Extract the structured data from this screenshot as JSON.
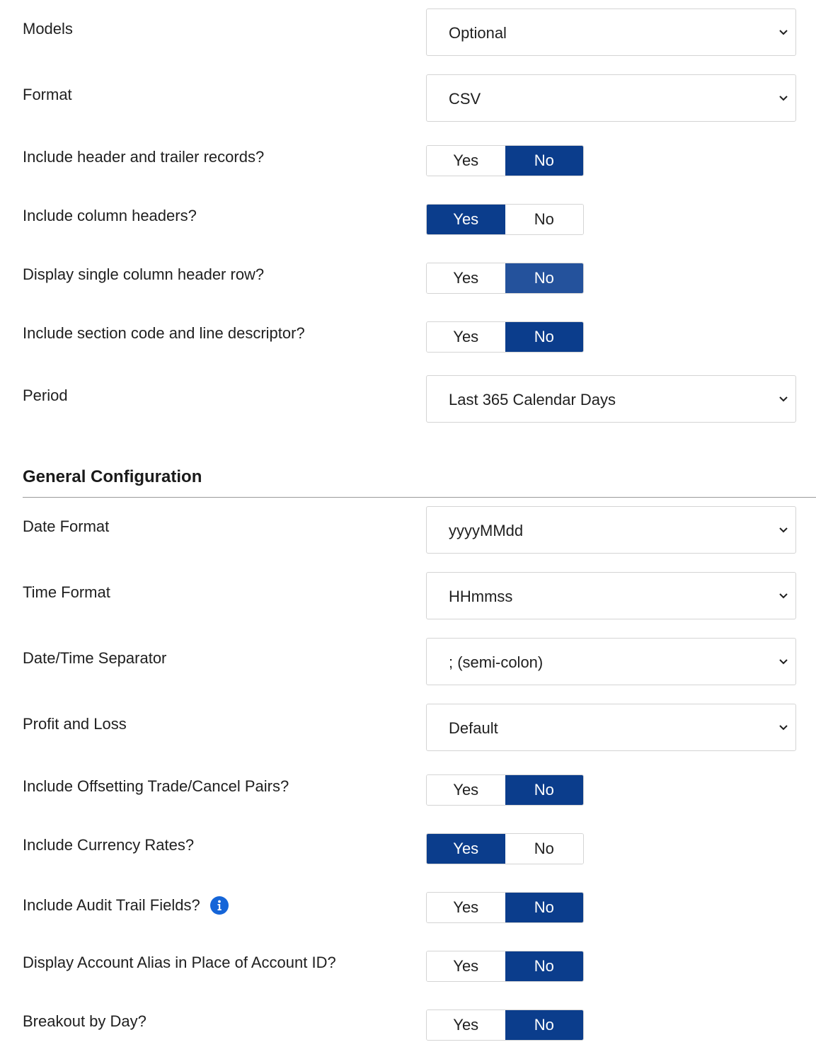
{
  "fields": {
    "models": {
      "label": "Models",
      "value": "Optional"
    },
    "format": {
      "label": "Format",
      "value": "CSV"
    },
    "header_trailer": {
      "label": "Include header and trailer records?",
      "yes": "Yes",
      "no": "No",
      "selected": "No"
    },
    "column_headers": {
      "label": "Include column headers?",
      "yes": "Yes",
      "no": "No",
      "selected": "Yes"
    },
    "single_header_row": {
      "label": "Display single column header row?",
      "yes": "Yes",
      "no": "No",
      "selected": "No"
    },
    "section_code": {
      "label": "Include section code and line descriptor?",
      "yes": "Yes",
      "no": "No",
      "selected": "No"
    },
    "period": {
      "label": "Period",
      "value": "Last 365 Calendar Days"
    }
  },
  "general_configuration": {
    "title": "General Configuration",
    "date_format": {
      "label": "Date Format",
      "value": "yyyyMMdd"
    },
    "time_format": {
      "label": "Time Format",
      "value": "HHmmss"
    },
    "datetime_separator": {
      "label": "Date/Time Separator",
      "value": "; (semi-colon)"
    },
    "profit_loss": {
      "label": "Profit and Loss",
      "value": "Default"
    },
    "offsetting_pairs": {
      "label": "Include Offsetting Trade/Cancel Pairs?",
      "yes": "Yes",
      "no": "No",
      "selected": "No"
    },
    "currency_rates": {
      "label": "Include Currency Rates?",
      "yes": "Yes",
      "no": "No",
      "selected": "Yes"
    },
    "audit_trail": {
      "label": "Include Audit Trail Fields?",
      "yes": "Yes",
      "no": "No",
      "selected": "No",
      "icon": "info-icon"
    },
    "account_alias": {
      "label": "Display Account Alias in Place of Account ID?",
      "yes": "Yes",
      "no": "No",
      "selected": "No"
    },
    "breakout_by_day": {
      "label": "Breakout by Day?",
      "yes": "Yes",
      "no": "No",
      "selected": "No"
    }
  },
  "colors": {
    "active_toggle": "#0b3d8c",
    "hover_toggle": "#24529c",
    "info_icon": "#1565d8"
  }
}
